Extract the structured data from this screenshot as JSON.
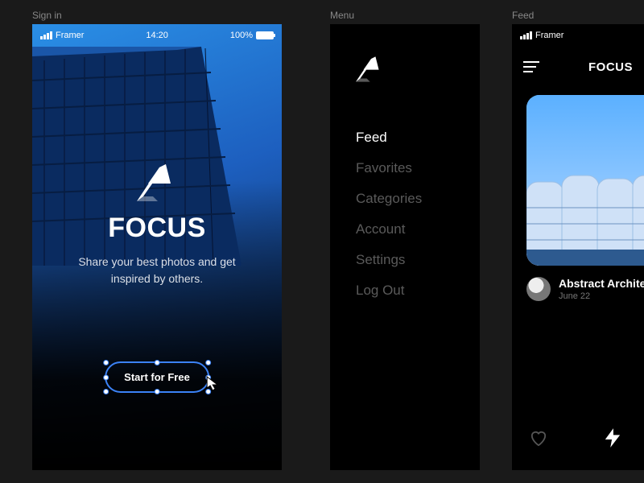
{
  "labels": {
    "signin": "Sign in",
    "menu": "Menu",
    "feed": "Feed"
  },
  "status": {
    "carrier": "Framer",
    "time": "14:20",
    "battery": "100%"
  },
  "signin": {
    "app_title": "FOCUS",
    "tagline": "Share your best photos and get inspired by others.",
    "cta": "Start for Free"
  },
  "menu": {
    "items": [
      {
        "label": "Feed",
        "active": true
      },
      {
        "label": "Favorites",
        "active": false
      },
      {
        "label": "Categories",
        "active": false
      },
      {
        "label": "Account",
        "active": false
      },
      {
        "label": "Settings",
        "active": false
      },
      {
        "label": "Log Out",
        "active": false
      }
    ]
  },
  "feed": {
    "title": "FOCUS",
    "card": {
      "title": "Abstract Architecture",
      "date": "June 22"
    }
  },
  "colors": {
    "selection": "#3b82f6",
    "sky": "#6fb8ff"
  }
}
